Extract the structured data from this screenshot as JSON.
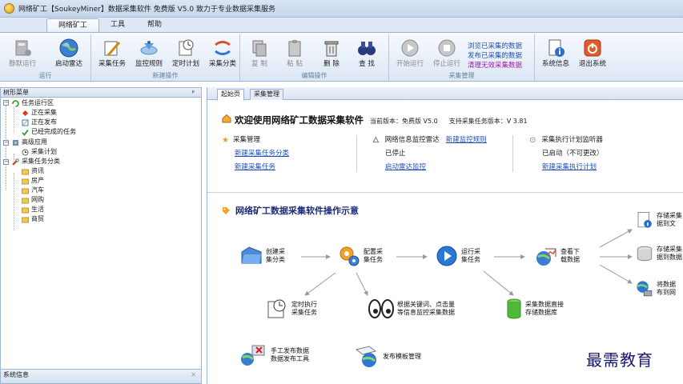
{
  "window": {
    "title": "网络矿工【SoukeyMiner】数据采集软件 免费版 V5.0 致力于专业数据采集服务"
  },
  "menu": {
    "tabs": [
      "网络矿工",
      "工具",
      "帮助"
    ]
  },
  "ribbon": {
    "groups": [
      "运行",
      "新建操作",
      "编辑操作",
      "采集管理"
    ],
    "buttons": {
      "silent_run": "静默运行",
      "start_radar": "启动雷达",
      "collect_task": "采集任务",
      "monitor_rule": "监控规则",
      "timer_plan": "定时计划",
      "collect_category": "采集分类",
      "copy": "复 制",
      "paste": "粘 贴",
      "delete": "删 除",
      "find": "查 找",
      "start_run": "开始运行",
      "stop_run": "停止运行",
      "system_info": "系统信息",
      "exit_system": "退出系统"
    },
    "collect_links": [
      "浏览已采集的数据",
      "发布已采集的数据",
      "清理无效采集数据"
    ]
  },
  "left_panel": {
    "header": "树形菜单",
    "pin": "ᵖ",
    "tree": {
      "task_running": "任务运行区",
      "collecting": "正在采集",
      "publishing": "正在发布",
      "completed": "已经完成的任务",
      "advanced": "高级应用",
      "collect_plan": "采集计划",
      "task_category": "采集任务分类",
      "categories": [
        "资讯",
        "房产",
        "汽车",
        "网购",
        "生活",
        "商贸"
      ]
    },
    "sysinfo": "系统信息",
    "sysinfo_close": "✕"
  },
  "doc_tabs": [
    "起始页",
    "采集管理"
  ],
  "welcome": {
    "title": "欢迎使用网络矿工数据采集软件",
    "version": "当前版本：免费版 V5.0",
    "task_version": "支持采集任务版本：V 3.81"
  },
  "collect_mgmt": {
    "title": "采集管理",
    "link1": "新建采集任务分类",
    "link2": "新建采集任务"
  },
  "radar": {
    "title": "网络信息监控雷达",
    "link_rule": "新建监控规则",
    "status": "已停止",
    "link_start": "启动雷达监控"
  },
  "monitor": {
    "title": "采集执行计划监听器",
    "status": "已启动（不可更改）",
    "link": "新建采集执行计划"
  },
  "diagram": {
    "title": "网络矿工数据采集软件操作示意",
    "create_category": "创建采\n集分类",
    "config_task": "配置采\n集任务",
    "run_task": "运行采\n集任务",
    "view_download": "查看下\n载数据",
    "store_file": "存储采集\n据到文",
    "store_db": "存储采集\n据到数据",
    "publish_web": "将数据\n布到网",
    "timed_exec": "定时执行\n采集任务",
    "keyword": "根据关键词、点击量\n等信息监控采集数据",
    "direct_store": "采集数据直接\n存储数据库",
    "manual_publish": "手工发布数据\n数据发布工具",
    "publish_template": "发布模板管理"
  },
  "watermark": "最需教育"
}
